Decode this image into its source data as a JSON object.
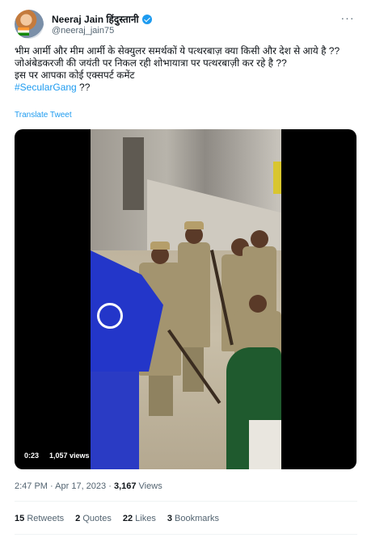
{
  "author": {
    "name": "Neeraj Jain हिंदुस्तानी",
    "handle": "@neeraj_jain75",
    "verified": true
  },
  "menu": {
    "more_icon": "more-horizontal-icon",
    "more_label": "···"
  },
  "tweet": {
    "lines": [
      "भीम आर्मी और मीम आर्मी के सेक्युलर समर्थकों ये पत्थरबाज़ क्या किसी और देश से आये है ??",
      "जोअंबेडकरजी की जयंती पर निकल रही शोभायात्रा पर पत्थरबाज़ी कर रहे है ??",
      "इस पर आपका कोई एक्सपर्ट कमेंट"
    ],
    "hashtag": "#SecularGang",
    "hashtag_suffix": " ??",
    "translate_label": "Translate Tweet"
  },
  "video": {
    "time": "0:23",
    "views": "1,057 views"
  },
  "meta": {
    "time": "2:47 PM",
    "separator": "·",
    "date": "Apr 17, 2023",
    "views_count": "3,167",
    "views_label": "Views"
  },
  "stats": {
    "retweets_count": "15",
    "retweets_label": "Retweets",
    "quotes_count": "2",
    "quotes_label": "Quotes",
    "likes_count": "22",
    "likes_label": "Likes",
    "bookmarks_count": "3",
    "bookmarks_label": "Bookmarks"
  },
  "colors": {
    "link": "#1d9bf0",
    "text": "#0f1419",
    "secondary": "#536471"
  }
}
